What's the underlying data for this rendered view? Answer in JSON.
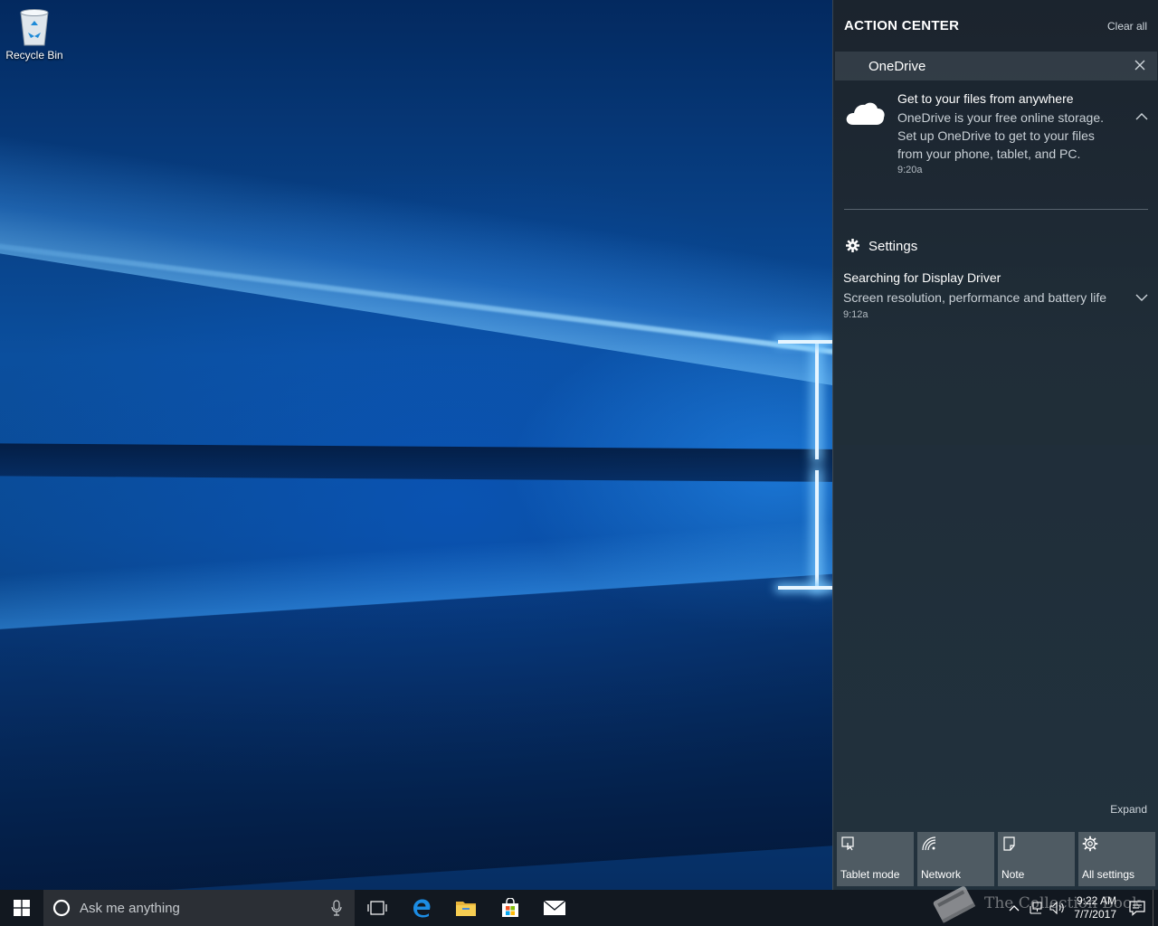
{
  "desktop": {
    "icons": [
      {
        "label": "Recycle Bin",
        "icon": "recycle-bin-icon"
      }
    ]
  },
  "action_center": {
    "title": "ACTION CENTER",
    "clear_all": "Clear all",
    "groups": [
      {
        "app": "OneDrive",
        "icon": "onedrive-cloud-icon",
        "notification": {
          "title": "Get to your files from anywhere",
          "body_lines": [
            "OneDrive is your free online storage.",
            "Set up OneDrive to get to your files",
            "from your phone, tablet, and PC."
          ],
          "time": "9:20a",
          "expanded": true
        }
      },
      {
        "app": "Settings",
        "icon": "gear-icon",
        "notification": {
          "title": "Searching for Display Driver",
          "body": "Screen resolution, performance and battery life",
          "time": "9:12a",
          "expanded": false
        }
      }
    ],
    "expand_label": "Expand",
    "quick_actions": [
      {
        "label": "Tablet mode",
        "icon": "tablet-mode-icon"
      },
      {
        "label": "Network",
        "icon": "network-icon"
      },
      {
        "label": "Note",
        "icon": "note-icon"
      },
      {
        "label": "All settings",
        "icon": "gear-icon"
      }
    ]
  },
  "taskbar": {
    "search_placeholder": "Ask me anything",
    "pinned": [
      "task-view-icon",
      "edge-icon",
      "file-explorer-icon",
      "store-icon",
      "mail-icon"
    ],
    "clock": {
      "time": "9:22 AM",
      "date": "7/7/2017"
    }
  },
  "watermark": {
    "text": "The Collection Book"
  },
  "colors": {
    "accent": "#0078d7",
    "action_center_bg": "#1f2a33",
    "taskbar_bg": "#121820",
    "search_bg": "#2b2f35"
  }
}
